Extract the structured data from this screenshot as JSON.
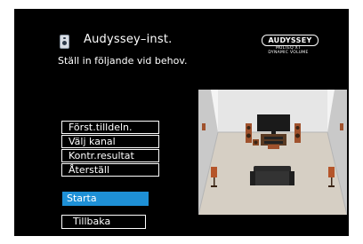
{
  "header": {
    "title": "Audyssey–inst.",
    "subtitle": "Ställ in följande vid behov."
  },
  "logo": {
    "brand": "AUDYSSEY",
    "line1": "MULTEQ XT",
    "line2": "DYNAMIC VOLUME"
  },
  "menu": {
    "items": [
      {
        "label": "Först.tilldeln."
      },
      {
        "label": "Välj kanal"
      },
      {
        "label": "Kontr.resultat"
      },
      {
        "label": "Återställ"
      }
    ],
    "start_label": "Starta",
    "back_label": "Tillbaka"
  },
  "colors": {
    "background": "#000000",
    "text": "#ffffff",
    "highlight": "#1e90d6"
  }
}
